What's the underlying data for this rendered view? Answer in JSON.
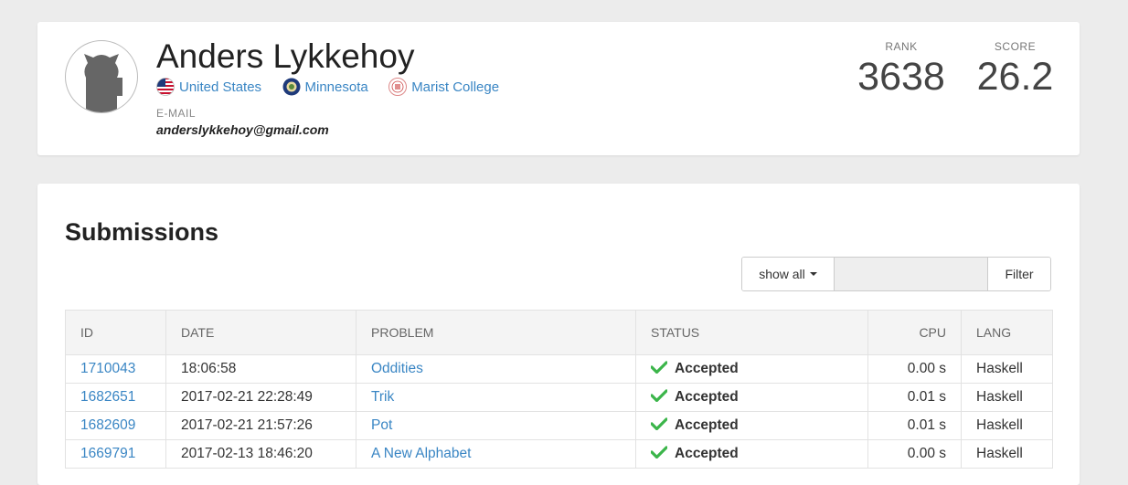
{
  "profile": {
    "name": "Anders Lykkehoy",
    "affiliations": [
      {
        "icon": "us-flag-icon",
        "label": "United States"
      },
      {
        "icon": "minnesota-seal-icon",
        "label": "Minnesota"
      },
      {
        "icon": "college-logo-icon",
        "label": "Marist College"
      }
    ],
    "email_label": "E-MAIL",
    "email": "anderslykkehoy@gmail.com",
    "rank_label": "RANK",
    "rank": "3638",
    "score_label": "SCORE",
    "score": "26.2"
  },
  "submissions": {
    "title": "Submissions",
    "filter_dropdown": "show all",
    "filter_placeholder": "",
    "filter_button": "Filter",
    "columns": [
      "ID",
      "DATE",
      "PROBLEM",
      "STATUS",
      "CPU",
      "LANG"
    ],
    "rows": [
      {
        "id": "1710043",
        "date": "18:06:58",
        "problem": "Oddities",
        "status": "Accepted",
        "cpu": "0.00 s",
        "lang": "Haskell"
      },
      {
        "id": "1682651",
        "date": "2017-02-21 22:28:49",
        "problem": "Trik",
        "status": "Accepted",
        "cpu": "0.01 s",
        "lang": "Haskell"
      },
      {
        "id": "1682609",
        "date": "2017-02-21 21:57:26",
        "problem": "Pot",
        "status": "Accepted",
        "cpu": "0.01 s",
        "lang": "Haskell"
      },
      {
        "id": "1669791",
        "date": "2017-02-13 18:46:20",
        "problem": "A New Alphabet",
        "status": "Accepted",
        "cpu": "0.00 s",
        "lang": "Haskell"
      }
    ]
  },
  "colors": {
    "link": "#3a86c4",
    "accepted": "#3bb54a",
    "background": "#ececec"
  }
}
